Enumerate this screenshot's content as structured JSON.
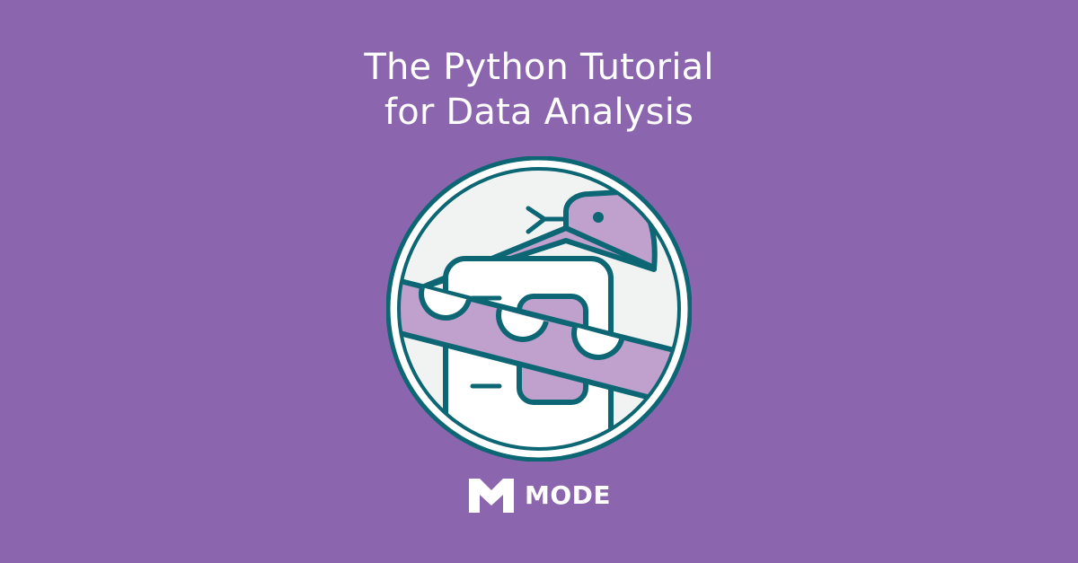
{
  "page": {
    "title_line1": "The Python Tutorial",
    "title_line2": "for Data Analysis"
  },
  "illustration": {
    "icons": [
      "python-snake-icon",
      "conveyor-belt-icon",
      "data-document-icon"
    ]
  },
  "brand": {
    "name": "MODE",
    "logo_icon": "mode-m-logo-icon"
  },
  "colors": {
    "background": "#8B65AD",
    "teal": "#0D6674",
    "lavender": "#C0A0CC",
    "light_gray": "#F1F3F2",
    "white": "#FFFFFF"
  }
}
